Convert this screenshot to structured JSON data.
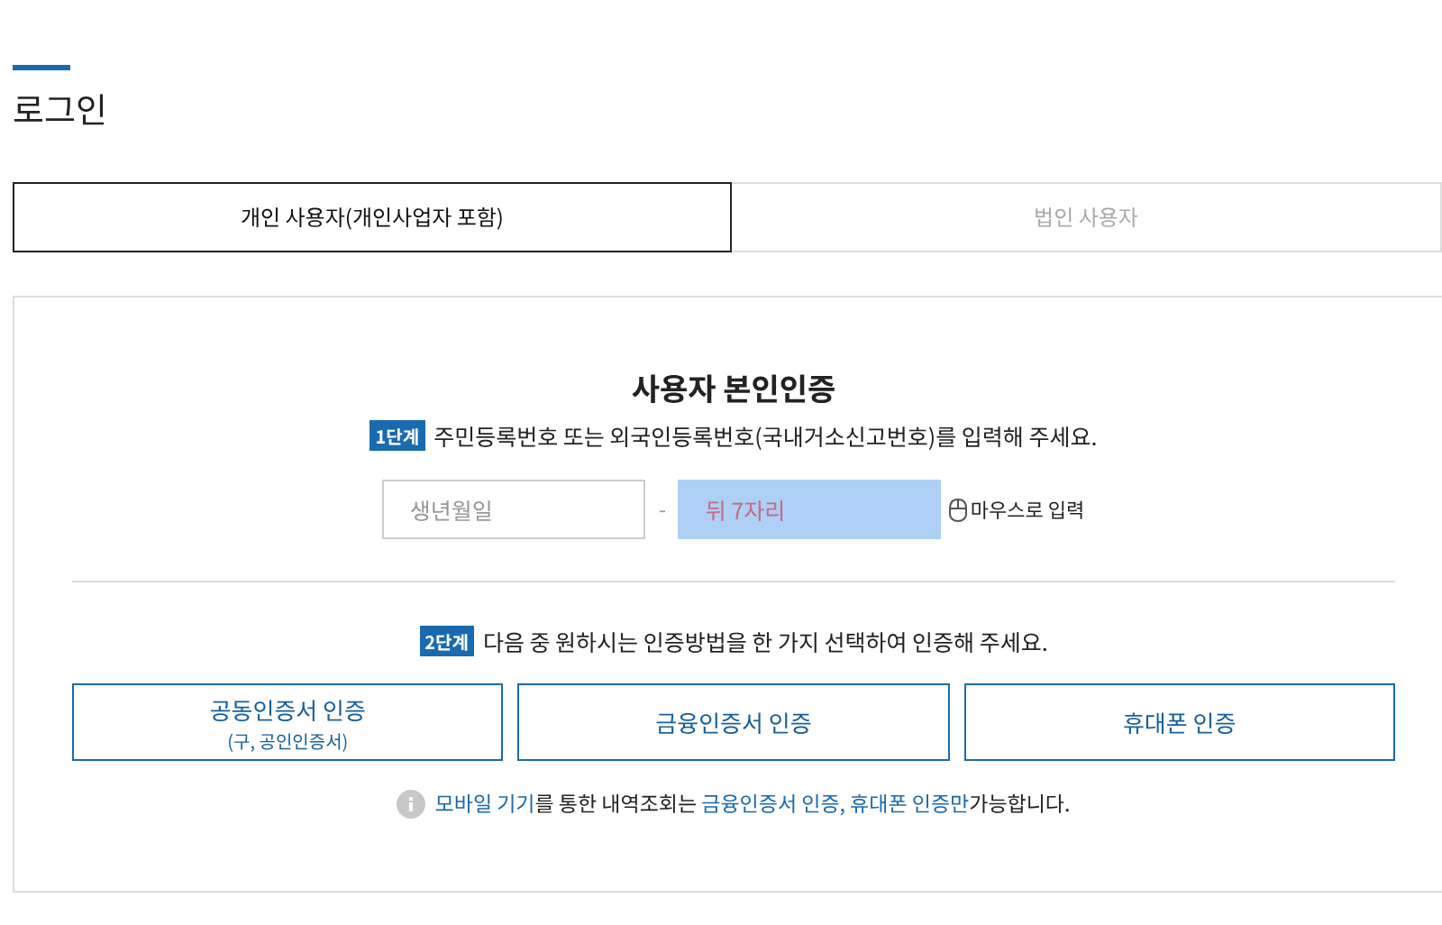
{
  "page": {
    "title": "로그인"
  },
  "tabs": [
    {
      "label": "개인 사용자(개인사업자 포함)",
      "selected": true
    },
    {
      "label": "법인 사용자",
      "selected": false
    }
  ],
  "card": {
    "heading": "사용자 본인인증",
    "step1": {
      "badge": "1단계",
      "text": "주민등록번호 또는 외국인등록번호(국내거소신고번호)를 입력해 주세요."
    },
    "birth_field": {
      "placeholder": "생년월일"
    },
    "separator": "-",
    "back_field": {
      "placeholder": "뒤 7자리"
    },
    "mouse_input": "마우스로 입력",
    "step2": {
      "badge": "2단계",
      "text": "다음 중 원하시는 인증방법을 한 가지 선택하여 인증해 주세요."
    },
    "methods": [
      {
        "label": "공동인증서 인증",
        "sub": "(구, 공인인증서)"
      },
      {
        "label": "금융인증서 인증"
      },
      {
        "label": "휴대폰 인증"
      }
    ],
    "note": [
      {
        "kind": "link",
        "text": "모바일 기기"
      },
      {
        "kind": "plain",
        "text": "를 통한 내역조회는 "
      },
      {
        "kind": "link",
        "text": "금융인증서 인증, 휴대폰 인증만"
      },
      {
        "kind": "plain",
        "text": "가능합니다."
      }
    ]
  }
}
